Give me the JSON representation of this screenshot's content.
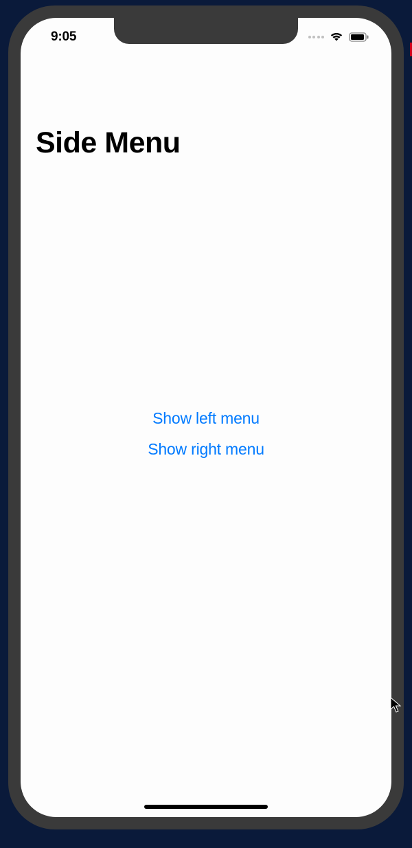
{
  "statusBar": {
    "time": "9:05"
  },
  "page": {
    "title": "Side Menu"
  },
  "buttons": {
    "showLeft": "Show left menu",
    "showRight": "Show right menu"
  },
  "colors": {
    "linkBlue": "#007aff",
    "frameGray": "#3a3a3a",
    "screenBg": "#fdfdfd"
  }
}
